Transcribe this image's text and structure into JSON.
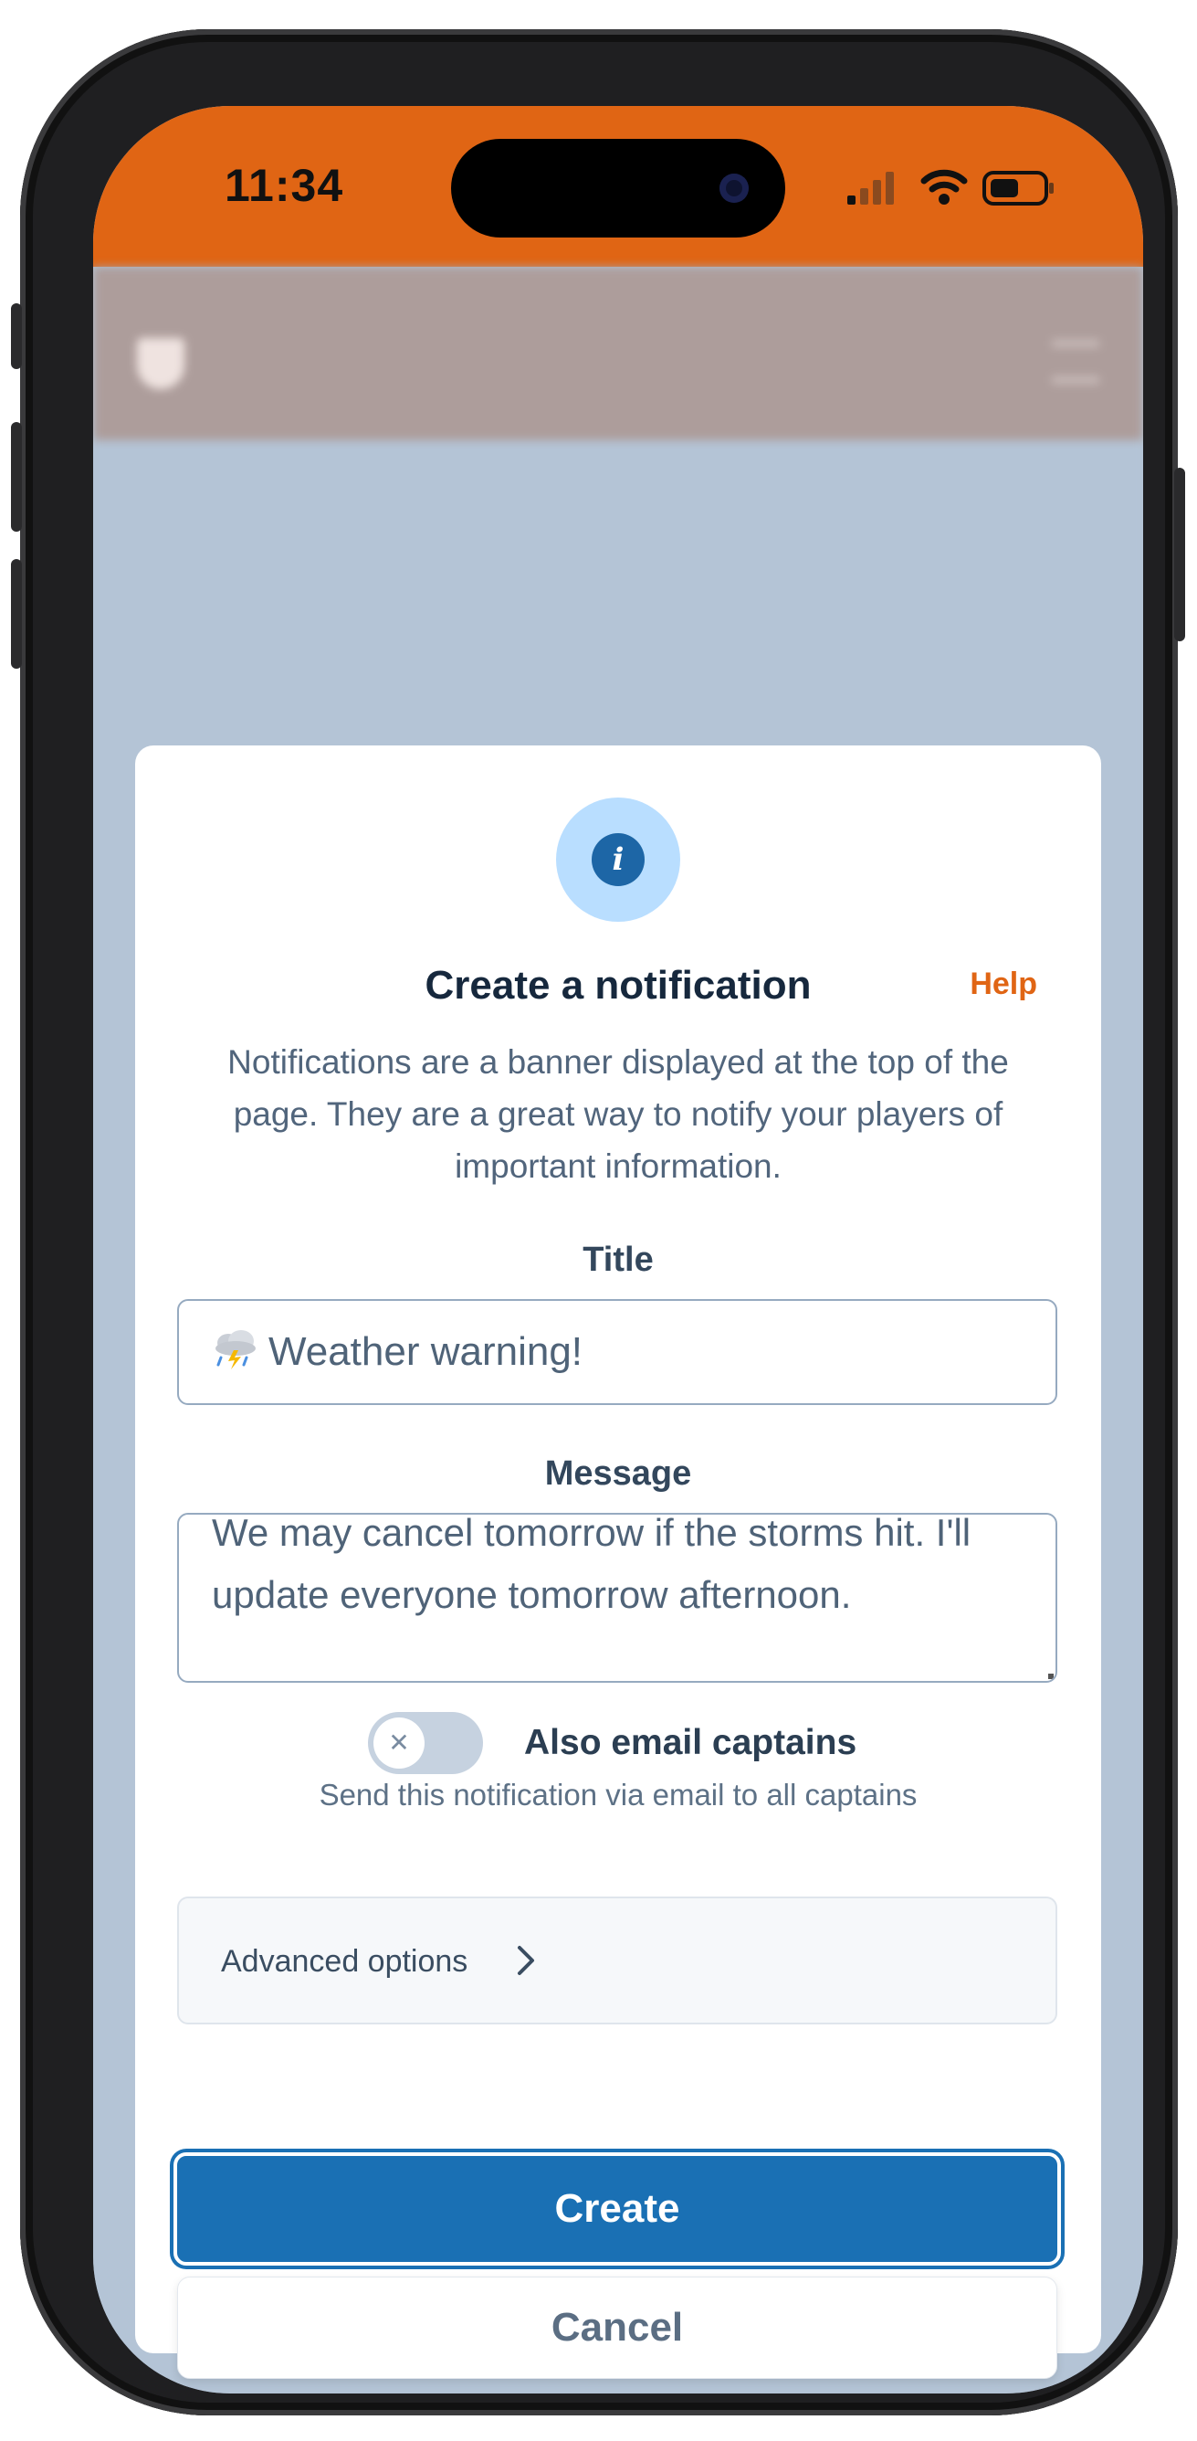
{
  "status_bar": {
    "time": "11:34",
    "signal_icon": "cellular-signal-icon",
    "wifi_icon": "wifi-icon",
    "battery_icon": "battery-icon"
  },
  "colors": {
    "accent_orange": "#e06514",
    "primary_blue": "#1a70b4",
    "info_circle": "#b9deff",
    "heading_text": "#16283d",
    "body_text": "#51657c"
  },
  "modal": {
    "icon": "info-icon",
    "title": "Create a notification",
    "help_link": "Help",
    "description": "Notifications are a banner displayed at the top of the page. They are a great way to notify your players of important information.",
    "title_field": {
      "label": "Title",
      "icon": "thunderstorm-emoji-icon",
      "value": "Weather warning!"
    },
    "message_field": {
      "label": "Message",
      "value": "We may cancel tomorrow if the storms hit. I'll update everyone tomorrow afternoon."
    },
    "email_toggle": {
      "label": "Also email captains",
      "help": "Send this notification via email to all captains",
      "checked": false
    },
    "advanced": {
      "label": "Advanced options"
    },
    "create_label": "Create",
    "cancel_label": "Cancel"
  }
}
